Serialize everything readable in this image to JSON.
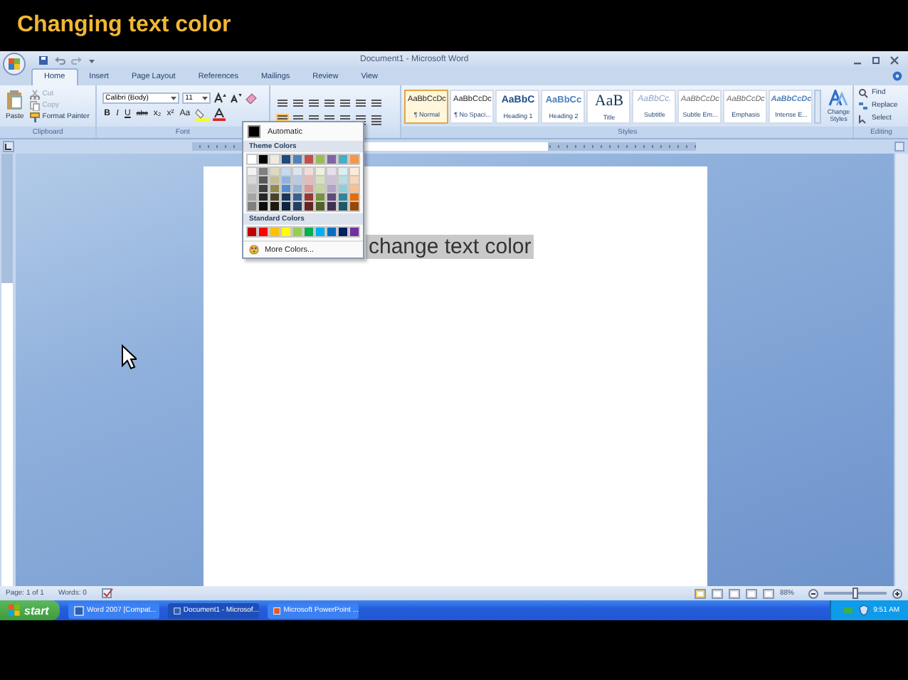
{
  "slide_title": "Changing text color",
  "window": {
    "title": "Document1 - Microsoft Word"
  },
  "tabs": [
    {
      "label": "Home",
      "selected": true
    },
    {
      "label": "Insert",
      "selected": false
    },
    {
      "label": "Page Layout",
      "selected": false
    },
    {
      "label": "References",
      "selected": false
    },
    {
      "label": "Mailings",
      "selected": false
    },
    {
      "label": "Review",
      "selected": false
    },
    {
      "label": "View",
      "selected": false
    }
  ],
  "ribbon": {
    "clipboard": {
      "paste": "Paste",
      "items": [
        "Cut",
        "Copy",
        "Format Painter"
      ],
      "label": "Clipboard"
    },
    "font": {
      "name": "Calibri (Body)",
      "size": "11",
      "buttons": [
        "B",
        "I",
        "U",
        "abc",
        "x₂",
        "x²",
        "Aa"
      ],
      "label": "Font"
    },
    "styles": {
      "items": [
        {
          "preview": "AaBbCcDc",
          "name": "¶ Normal",
          "kind": "normal",
          "selected": true
        },
        {
          "preview": "AaBbCcDc",
          "name": "¶ No Spaci...",
          "kind": "normal",
          "selected": false
        },
        {
          "preview": "AaBbC",
          "name": "Heading 1",
          "kind": "heading1",
          "selected": false
        },
        {
          "preview": "AaBbCc",
          "name": "Heading 2",
          "kind": "heading2",
          "selected": false
        },
        {
          "preview": "AaB",
          "name": "Title",
          "kind": "title",
          "selected": false
        },
        {
          "preview": "AaBbCc.",
          "name": "Subtitle",
          "kind": "subtitle",
          "selected": false
        },
        {
          "preview": "AaBbCcDc",
          "name": "Subtle Em...",
          "kind": "emphasis",
          "selected": false
        },
        {
          "preview": "AaBbCcDc",
          "name": "Emphasis",
          "kind": "emphasis",
          "selected": false
        },
        {
          "preview": "AaBbCcDc",
          "name": "Intense E...",
          "kind": "intense",
          "selected": false
        }
      ],
      "label": "Styles"
    },
    "change_styles": "Change Styles",
    "editing": {
      "items": [
        "Find",
        "Replace",
        "Select"
      ],
      "label": "Editing"
    }
  },
  "document": {
    "text": "change text color",
    "selected": true
  },
  "color_menu": {
    "automatic": "Automatic",
    "theme_header": "Theme Colors",
    "theme_columns": [
      {
        "swatches": [
          {
            "color": "#ffffff"
          },
          {
            "color": "#f2f2f2"
          },
          {
            "color": "#d8d8d8"
          },
          {
            "color": "#bfbfbf"
          },
          {
            "color": "#a5a5a5"
          },
          {
            "color": "#7f7f7f"
          }
        ]
      },
      {
        "swatches": [
          {
            "color": "#000000"
          },
          {
            "color": "#7f7f7f"
          },
          {
            "color": "#595959"
          },
          {
            "color": "#3f3f3f"
          },
          {
            "color": "#262626"
          },
          {
            "color": "#0c0c0c"
          }
        ]
      },
      {
        "swatches": [
          {
            "color": "#eeece1"
          },
          {
            "color": "#ddd9c3"
          },
          {
            "color": "#c4bd97"
          },
          {
            "color": "#938953"
          },
          {
            "color": "#494429"
          },
          {
            "color": "#1d1b10"
          }
        ]
      },
      {
        "swatches": [
          {
            "color": "#1f497d"
          },
          {
            "color": "#c6d9f0"
          },
          {
            "color": "#8db3e2"
          },
          {
            "color": "#548dd4"
          },
          {
            "color": "#17365d"
          },
          {
            "color": "#0f243e"
          }
        ]
      },
      {
        "swatches": [
          {
            "color": "#4f81bd"
          },
          {
            "color": "#dbe5f1"
          },
          {
            "color": "#b8cce4"
          },
          {
            "color": "#95b3d7"
          },
          {
            "color": "#366092"
          },
          {
            "color": "#244061"
          }
        ]
      },
      {
        "swatches": [
          {
            "color": "#c0504d"
          },
          {
            "color": "#f2dcdb"
          },
          {
            "color": "#e5b9b7"
          },
          {
            "color": "#d99694"
          },
          {
            "color": "#953734"
          },
          {
            "color": "#632423"
          }
        ]
      },
      {
        "swatches": [
          {
            "color": "#9bbb59"
          },
          {
            "color": "#ebf1dd"
          },
          {
            "color": "#d7e3bc"
          },
          {
            "color": "#c3d69b"
          },
          {
            "color": "#76923c"
          },
          {
            "color": "#4f6128"
          }
        ]
      },
      {
        "swatches": [
          {
            "color": "#8064a2"
          },
          {
            "color": "#e5e0ec"
          },
          {
            "color": "#ccc1d9"
          },
          {
            "color": "#b2a2c7"
          },
          {
            "color": "#5f497a"
          },
          {
            "color": "#3f3151"
          }
        ]
      },
      {
        "swatches": [
          {
            "color": "#4bacc6"
          },
          {
            "color": "#dbeef3"
          },
          {
            "color": "#b7dde8"
          },
          {
            "color": "#92cddc"
          },
          {
            "color": "#31859b"
          },
          {
            "color": "#205867"
          }
        ]
      },
      {
        "swatches": [
          {
            "color": "#f79646"
          },
          {
            "color": "#fdeada"
          },
          {
            "color": "#fbd5b5"
          },
          {
            "color": "#fac08f"
          },
          {
            "color": "#e36c09"
          },
          {
            "color": "#974806"
          }
        ]
      }
    ],
    "standard_header": "Standard Colors",
    "standard": [
      {
        "color": "#c00000"
      },
      {
        "color": "#ff0000"
      },
      {
        "color": "#ffc000"
      },
      {
        "color": "#ffff00"
      },
      {
        "color": "#92d050"
      },
      {
        "color": "#00b050"
      },
      {
        "color": "#00b0f0"
      },
      {
        "color": "#0070c0"
      },
      {
        "color": "#002060"
      },
      {
        "color": "#7030a0"
      }
    ],
    "more": "More Colors..."
  },
  "status_bar": {
    "page": "Page: 1 of 1",
    "words": "Words: 0",
    "zoom": "88%",
    "zoom_slider": {
      "level": 0.5
    }
  },
  "taskbar": {
    "start": "start",
    "buttons": [
      {
        "label": "Word 2007 [Compat...",
        "selected": false
      },
      {
        "label": "Document1 - Microsof...",
        "selected": true
      },
      {
        "label": "Microsoft PowerPoint ...",
        "selected": false
      }
    ],
    "clock": "9:51 AM"
  }
}
